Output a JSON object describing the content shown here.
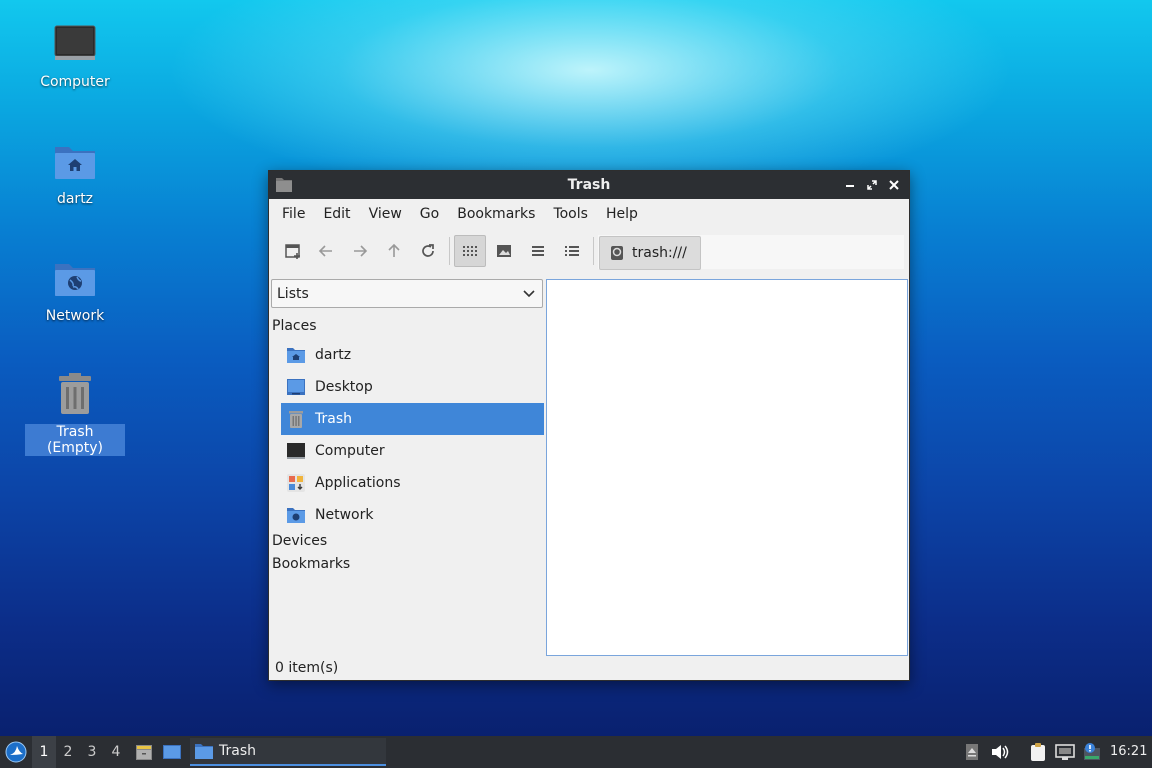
{
  "desktop": {
    "icons": [
      {
        "label": "Computer"
      },
      {
        "label": "dartz"
      },
      {
        "label": "Network"
      },
      {
        "label": "Trash (Empty)"
      }
    ]
  },
  "window": {
    "title": "Trash",
    "menu": [
      "File",
      "Edit",
      "View",
      "Go",
      "Bookmarks",
      "Tools",
      "Help"
    ],
    "path": "trash:///",
    "side_selector": "Lists",
    "sections": {
      "places": "Places",
      "devices": "Devices",
      "bookmarks": "Bookmarks"
    },
    "places": [
      {
        "label": "dartz",
        "icon": "home-folder-icon"
      },
      {
        "label": "Desktop",
        "icon": "desktop-icon"
      },
      {
        "label": "Trash",
        "icon": "trash-icon",
        "selected": true
      },
      {
        "label": "Computer",
        "icon": "computer-icon"
      },
      {
        "label": "Applications",
        "icon": "applications-icon"
      },
      {
        "label": "Network",
        "icon": "network-folder-icon"
      }
    ],
    "status": "0 item(s)"
  },
  "taskbar": {
    "workspaces": [
      "1",
      "2",
      "3",
      "4"
    ],
    "active_workspace": "1",
    "task_label": "Trash",
    "clock": "16:21"
  },
  "colors": {
    "selection": "#3f86d8",
    "titlebar": "#2c2f33",
    "taskbar": "#2b2e33",
    "folder": "#4a8ad8"
  }
}
